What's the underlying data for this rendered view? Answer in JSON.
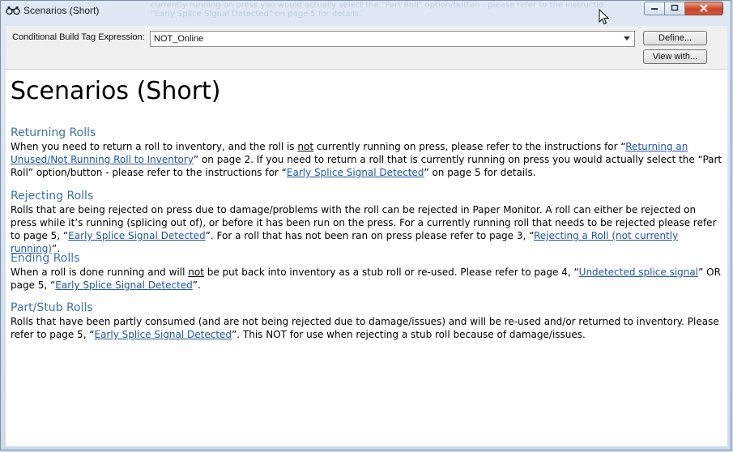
{
  "window": {
    "title": "Scenarios (Short)",
    "icon": "binoculars-icon",
    "bg_text": [
      "currently running on press you would actually select the \"Part Roll\" option/button - please refer to the instructions for",
      "\"Early Splice Signal Detected\" on page 5 for details."
    ]
  },
  "toolbar": {
    "label": "Conditional Build Tag Expression:",
    "expression_value": "NOT_Online",
    "define_label": "Define...",
    "view_with_label": "View with..."
  },
  "content": {
    "title": "Scenarios (Short)",
    "sections": [
      {
        "heading": "Returning Rolls",
        "p1": "When you need to return a roll to inventory, and the roll is ",
        "u1": "not",
        "p2": " currently running on press, please refer to the instructions for “",
        "link1": "Returning an Unused/Not Running Roll to Inventory",
        "p3": "” on page 2.  If you need to return a roll that is currently running on press you would actually select the “Part Roll” option/button - please refer to the instructions for “",
        "link2": "Early Splice Signal Detected",
        "p4": "” on page 5 for details."
      },
      {
        "heading": "Rejecting Rolls",
        "p1": "Rolls that are being rejected on press due to damage/problems with the roll can be rejected in Paper Monitor.  A roll can either be rejected on press while it’s running (splicing out of), or before it has been run on the press.  For a currently running roll that needs to be rejected please refer to page 5, “",
        "link1": "Early Splice Signal Detected",
        "p2": "”.  For a roll that has not been ran on press please refer to page 3, “",
        "link2": "Rejecting a Roll (not currently running)",
        "p3": "”."
      },
      {
        "heading": "Ending Rolls",
        "p1": "When a roll is done running and will ",
        "u1": "not",
        "p2": " be put back into inventory as a stub roll or re-used.  Please refer to page 4, “",
        "link1": "Undetected splice signal",
        "p3": "” OR page 5, “",
        "link2": "Early Splice Signal Detected",
        "p4": "”."
      },
      {
        "heading": "Part/Stub Rolls",
        "p1": "Rolls that have been partly consumed (and are not being rejected due to damage/issues) and will be re-used and/or returned to inventory.  Please refer to page 5, “",
        "link1": "Early Splice Signal Detected",
        "p2": "”.  This NOT for use when rejecting a stub roll because of damage/issues."
      }
    ]
  },
  "colors": {
    "heading": "#3d73b0",
    "link": "#1f56a8",
    "close_button": "#c7452a"
  }
}
